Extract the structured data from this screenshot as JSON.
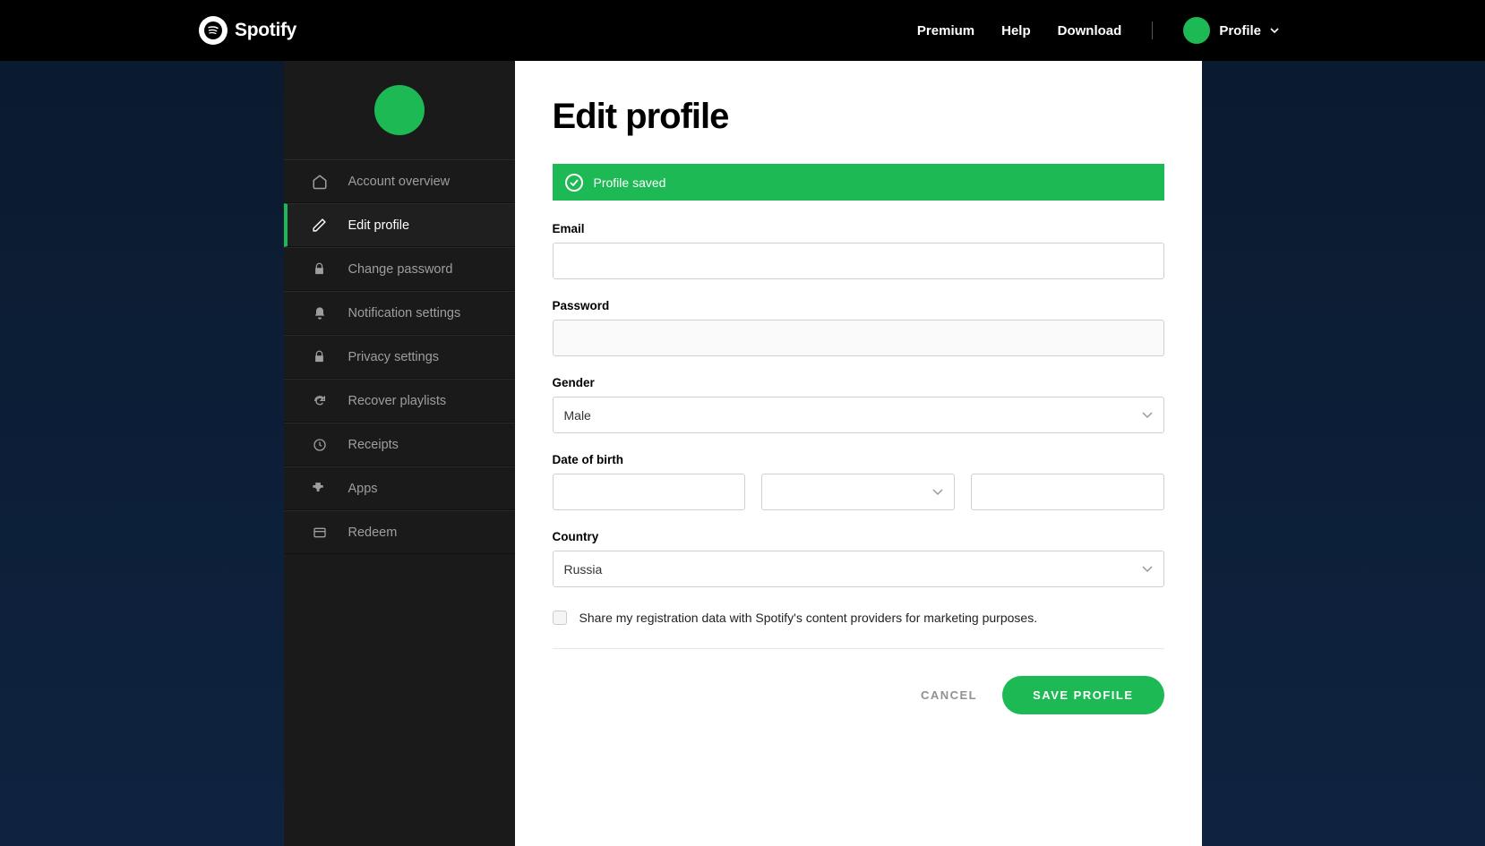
{
  "brand": "Spotify",
  "nav": {
    "premium": "Premium",
    "help": "Help",
    "download": "Download",
    "profile": "Profile"
  },
  "sidebar": {
    "items": [
      {
        "label": "Account overview"
      },
      {
        "label": "Edit profile"
      },
      {
        "label": "Change password"
      },
      {
        "label": "Notification settings"
      },
      {
        "label": "Privacy settings"
      },
      {
        "label": "Recover playlists"
      },
      {
        "label": "Receipts"
      },
      {
        "label": "Apps"
      },
      {
        "label": "Redeem"
      }
    ]
  },
  "main": {
    "title": "Edit profile",
    "alert": "Profile saved",
    "labels": {
      "email": "Email",
      "password": "Password",
      "gender": "Gender",
      "dob": "Date of birth",
      "country": "Country"
    },
    "values": {
      "email": "",
      "password": "",
      "gender": "Male",
      "dob_day": "",
      "dob_month": "",
      "dob_year": "",
      "country": "Russia"
    },
    "share_label": "Share my registration data with Spotify's content providers for marketing purposes.",
    "buttons": {
      "cancel": "CANCEL",
      "save": "SAVE PROFILE"
    }
  }
}
